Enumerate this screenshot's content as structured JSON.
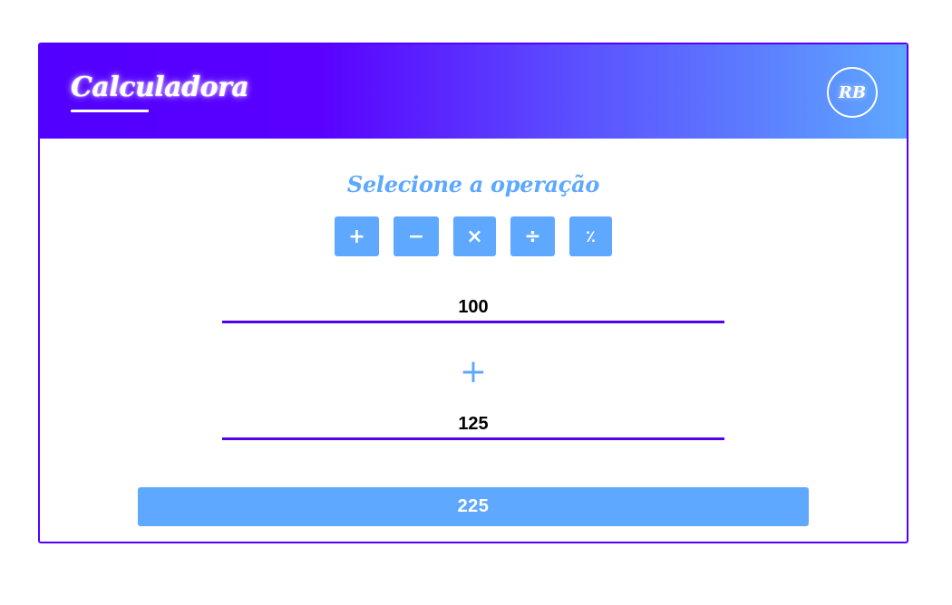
{
  "header": {
    "title": "Calculadora",
    "avatar_initials": "RB"
  },
  "main": {
    "subtitle": "Selecione a operação",
    "operations": [
      {
        "symbol": "+",
        "icon": "plus-icon"
      },
      {
        "symbol": "−",
        "icon": "minus-icon"
      },
      {
        "symbol": "×",
        "icon": "multiply-icon"
      },
      {
        "symbol": "÷",
        "icon": "divide-icon"
      },
      {
        "symbol": "٪",
        "icon": "percent-icon"
      }
    ],
    "first_value": "100",
    "operator_sign": "+",
    "second_value": "125",
    "result": "225"
  },
  "colors": {
    "border": "#5500ff",
    "accent": "#5ea8ff",
    "input_underline": "#5500ee",
    "header_gradient_start": "#5200ff",
    "header_gradient_end": "#5ea8ff"
  }
}
